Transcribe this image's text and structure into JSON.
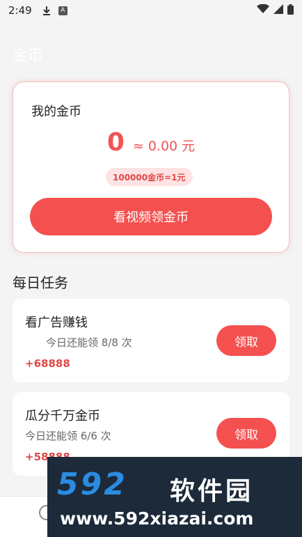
{
  "status_bar": {
    "time": "2:49",
    "a_icon": "A"
  },
  "header": {
    "title": "金币"
  },
  "coin_card": {
    "title": "我的金币",
    "coins": "0",
    "approx": "≈ 0.00 元",
    "rate": "100000金币=1元",
    "watch_button": "看视频领金币"
  },
  "daily": {
    "title": "每日任务",
    "tasks": [
      {
        "title": "看广告赚钱",
        "sub": "今日还能领 8/8 次",
        "reward": "+68888",
        "button": "领取"
      },
      {
        "title": "瓜分千万金币",
        "sub": "今日还能领 6/6 次",
        "reward": "+58888",
        "button": "领取"
      }
    ]
  },
  "watermark": {
    "brand": "592",
    "brand_cn": "软件园",
    "url": "www.592xiazai.com"
  },
  "colors": {
    "accent": "#f55050",
    "reward": "#e04848",
    "badge_bg": "#fde3e3"
  }
}
